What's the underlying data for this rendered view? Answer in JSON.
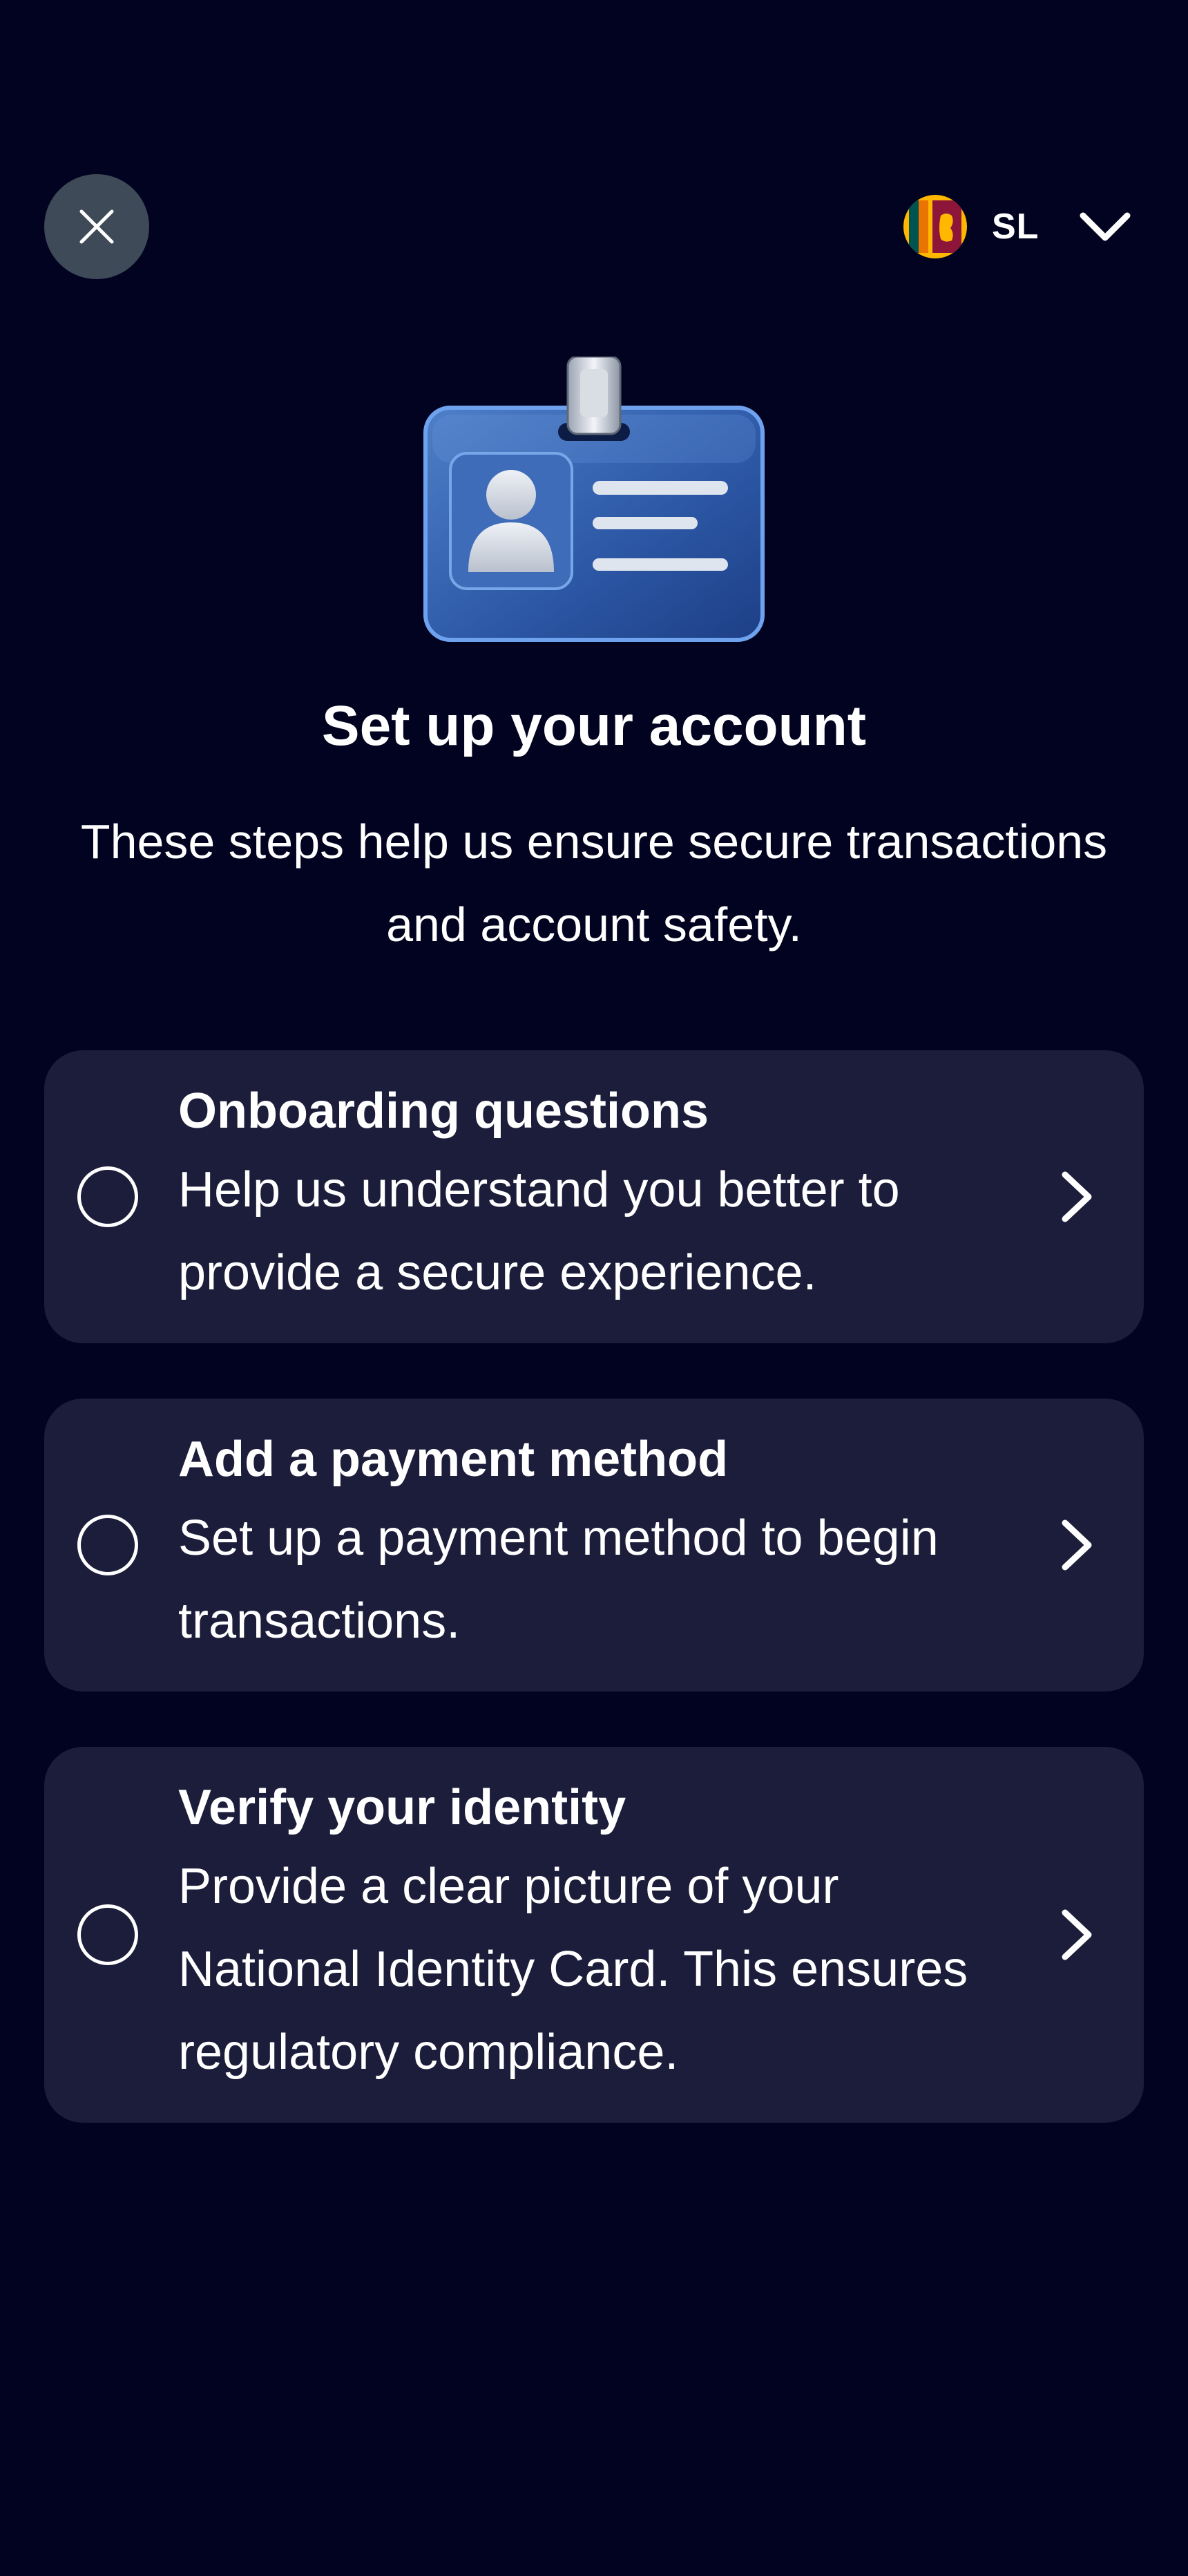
{
  "header": {
    "close_icon": "close-icon",
    "language": {
      "flag_icon": "sri-lanka-flag-icon",
      "code": "SL",
      "dropdown_icon": "chevron-down-icon"
    }
  },
  "hero": {
    "icon": "id-badge-icon"
  },
  "title": "Set up your account",
  "subtitle": "These steps help us ensure secure transactions and account safety.",
  "steps": [
    {
      "title": "Onboarding questions",
      "description": "Help us understand you better to provide a secure experience.",
      "completed": false
    },
    {
      "title": "Add a payment method",
      "description": "Set up a payment method to begin transactions.",
      "completed": false
    },
    {
      "title": "Verify your identity",
      "description": "Provide a clear picture of your National Identity Card. This ensures regulatory compliance.",
      "completed": false
    }
  ],
  "colors": {
    "background": "#020320",
    "card": "#1b1d3a",
    "close_button": "#3e4a57",
    "text": "#ffffff"
  }
}
